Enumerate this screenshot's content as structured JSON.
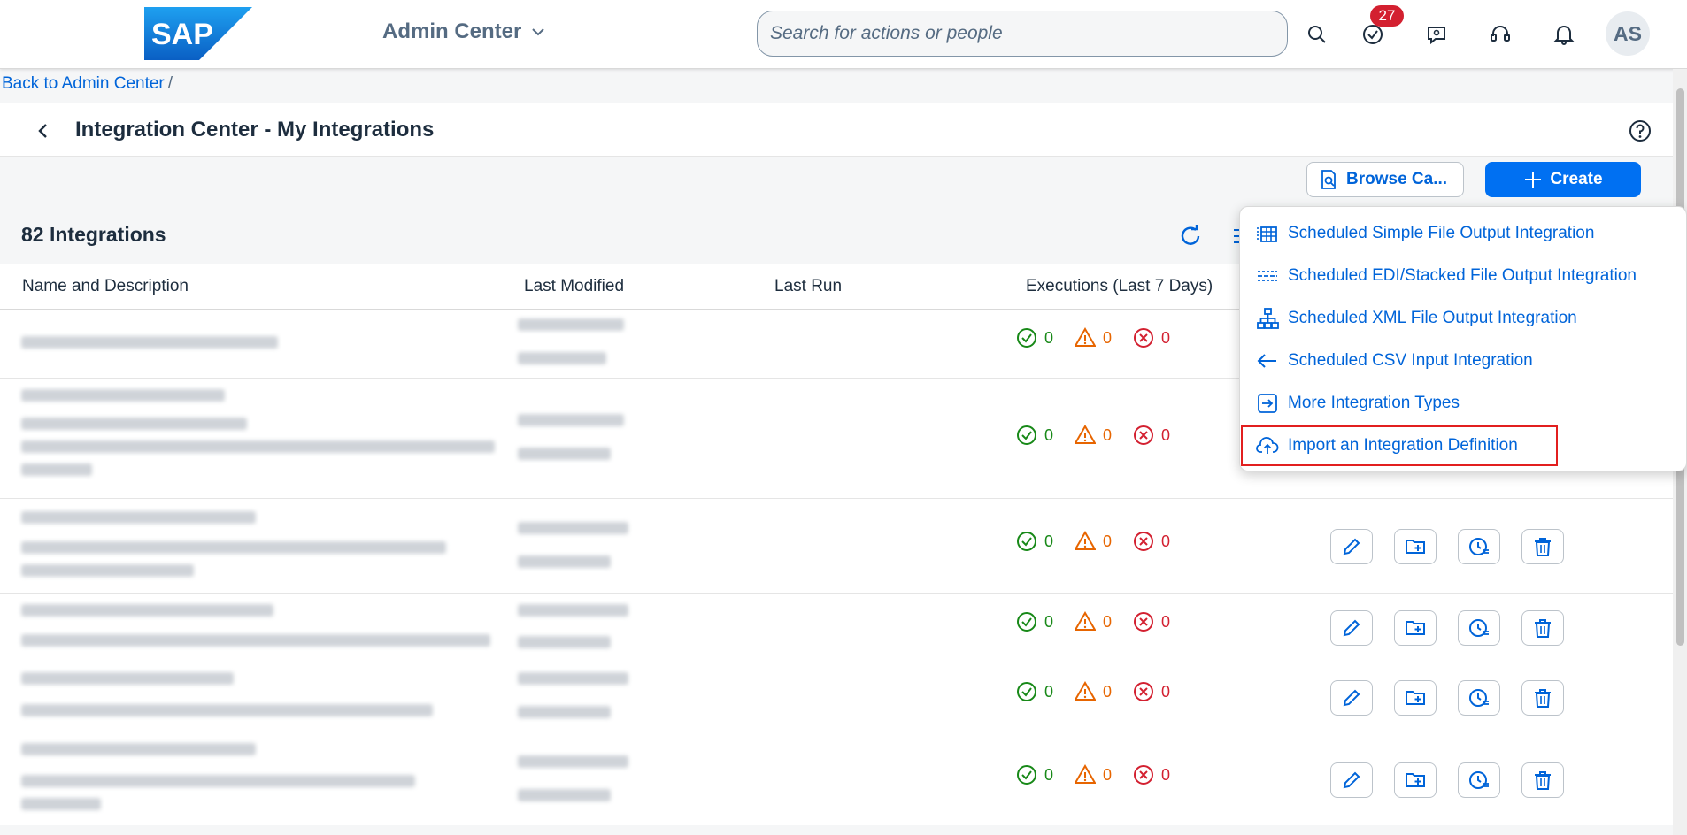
{
  "shell": {
    "logo_text": "SAP",
    "app_title": "Admin Center",
    "search_placeholder": "Search for actions or people",
    "notification_count": "27",
    "avatar_initials": "AS",
    "icons": [
      "search-icon",
      "approvals-icon",
      "feedback-icon",
      "support-icon",
      "notifications-icon"
    ]
  },
  "breadcrumb": {
    "link": "Back to Admin Center",
    "separator": "/"
  },
  "page": {
    "title": "Integration Center - My Integrations",
    "browse_label": "Browse Ca...",
    "create_label": "Create"
  },
  "table": {
    "count_title": "82 Integrations",
    "columns": [
      "Name and Description",
      "Last Modified",
      "Last Run",
      "Executions (Last 7 Days)"
    ],
    "rows": [
      {
        "success": "0",
        "warning": "0",
        "error": "0"
      },
      {
        "success": "0",
        "warning": "0",
        "error": "0"
      },
      {
        "success": "0",
        "warning": "0",
        "error": "0"
      },
      {
        "success": "0",
        "warning": "0",
        "error": "0"
      },
      {
        "success": "0",
        "warning": "0",
        "error": "0"
      },
      {
        "success": "0",
        "warning": "0",
        "error": "0"
      }
    ]
  },
  "create_menu": {
    "items": [
      {
        "label": "Scheduled Simple File Output Integration",
        "icon": "table-icon"
      },
      {
        "label": "Scheduled EDI/Stacked File Output Integration",
        "icon": "stacked-lines-icon"
      },
      {
        "label": "Scheduled XML File Output Integration",
        "icon": "hierarchy-icon"
      },
      {
        "label": "Scheduled CSV Input Integration",
        "icon": "arrow-left-icon"
      },
      {
        "label": "More Integration Types",
        "icon": "enter-icon"
      },
      {
        "label": "Import an Integration Definition",
        "icon": "cloud-upload-icon"
      }
    ]
  },
  "colors": {
    "brand_blue": "#0070f2",
    "link_blue": "#0064d9",
    "success": "#188918",
    "warning": "#e76500",
    "error": "#d32030",
    "highlight": "#e21f1f"
  }
}
